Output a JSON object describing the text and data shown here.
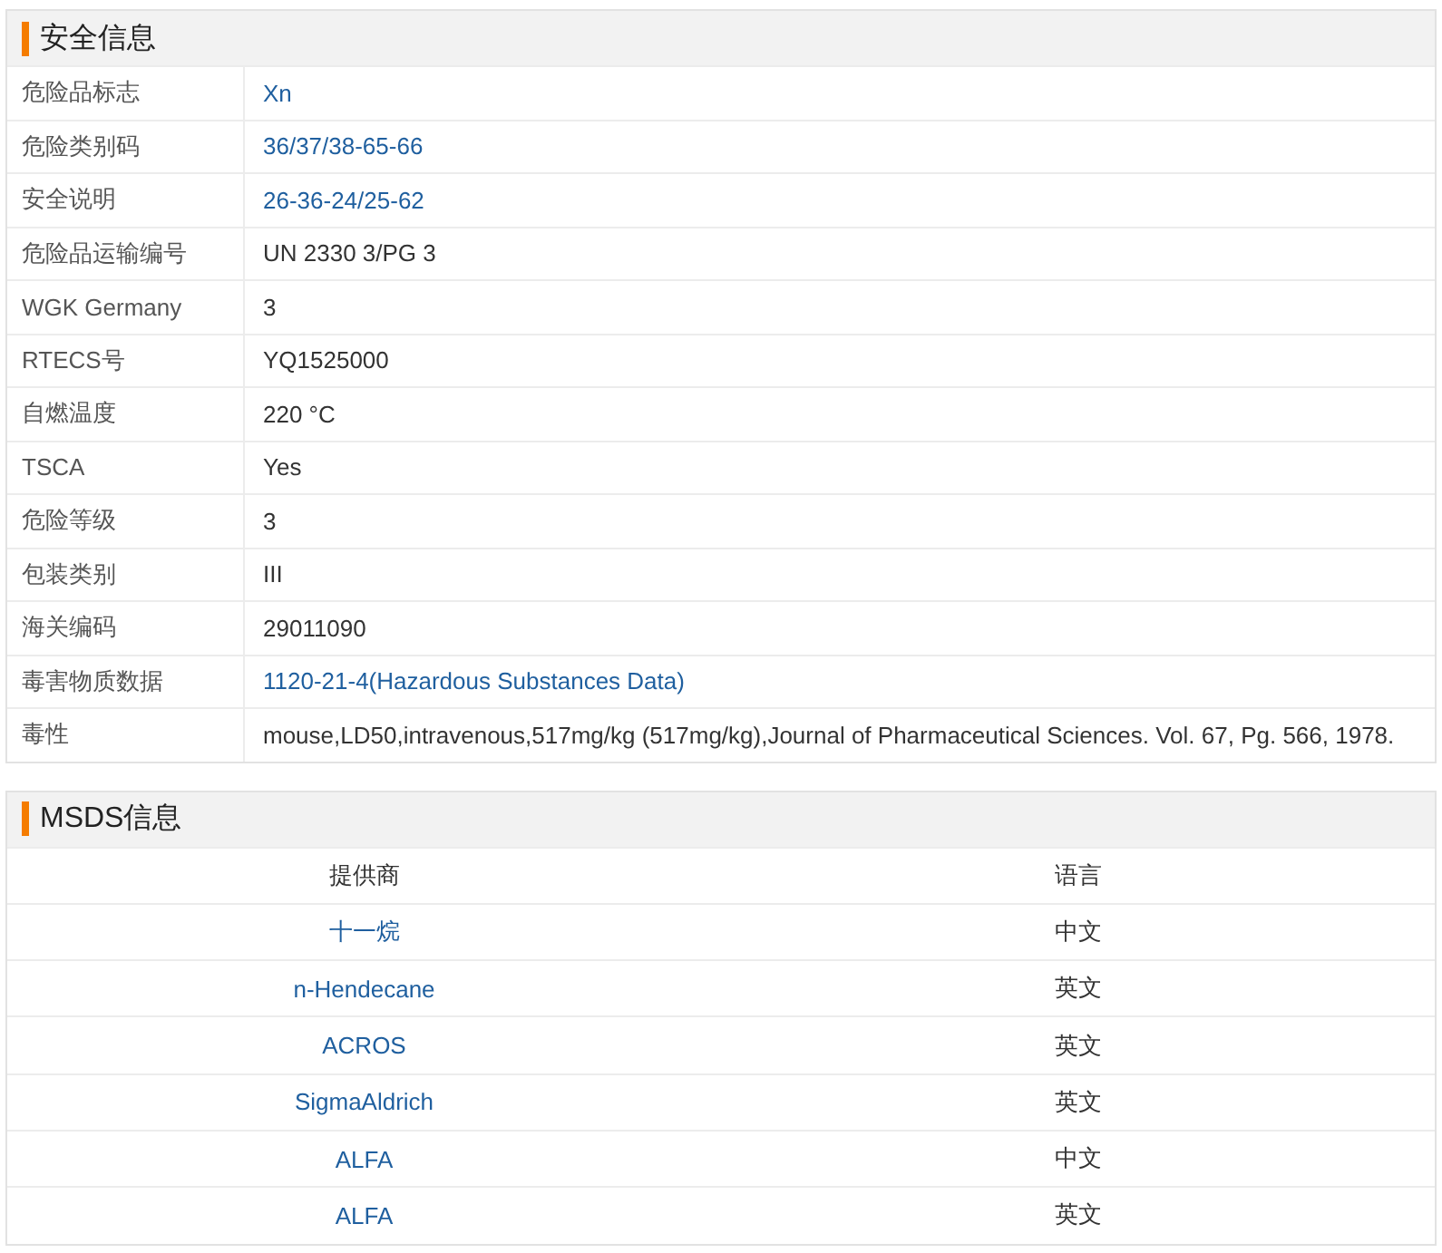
{
  "safety": {
    "title": "安全信息",
    "rows": [
      {
        "label": "危险品标志",
        "value": "Xn",
        "kind": "link"
      },
      {
        "label": "危险类别码",
        "value": "36/37/38-65-66",
        "kind": "link"
      },
      {
        "label": "安全说明",
        "value": "26-36-24/25-62",
        "kind": "link"
      },
      {
        "label": "危险品运输编号",
        "value": "UN 2330 3/PG 3",
        "kind": "text"
      },
      {
        "label": "WGK Germany",
        "value": "3",
        "kind": "text"
      },
      {
        "label": "RTECS号",
        "value": "YQ1525000",
        "kind": "text"
      },
      {
        "label": "自燃温度",
        "value": "220 °C",
        "kind": "text"
      },
      {
        "label": "TSCA",
        "value": "Yes",
        "kind": "text"
      },
      {
        "label": "危险等级",
        "value": "3",
        "kind": "text"
      },
      {
        "label": "包装类别",
        "value": "III",
        "kind": "text"
      },
      {
        "label": "海关编码",
        "value": "29011090",
        "kind": "text"
      },
      {
        "label": "毒害物质数据",
        "value": "1120-21-4(Hazardous Substances Data)",
        "kind": "link"
      },
      {
        "label": "毒性",
        "value": "mouse,LD50,intravenous,517mg/kg (517mg/kg),Journal of Pharmaceutical Sciences. Vol. 67, Pg. 566, 1978.",
        "kind": "text"
      }
    ]
  },
  "msds": {
    "title": "MSDS信息",
    "columns": [
      "提供商",
      "语言"
    ],
    "rows": [
      {
        "provider": "十一烷",
        "language": "中文"
      },
      {
        "provider": "n-Hendecane",
        "language": "英文"
      },
      {
        "provider": "ACROS",
        "language": "英文"
      },
      {
        "provider": "SigmaAldrich",
        "language": "英文"
      },
      {
        "provider": "ALFA",
        "language": "中文"
      },
      {
        "provider": "ALFA",
        "language": "英文"
      }
    ]
  }
}
